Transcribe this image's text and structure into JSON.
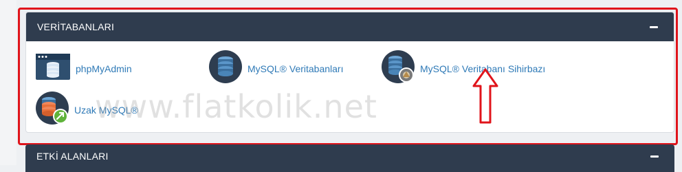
{
  "databases_panel": {
    "title": "VERİTABANLARI",
    "items": [
      {
        "label": "phpMyAdmin",
        "icon": "phpmyadmin-icon"
      },
      {
        "label": "MySQL® Veritabanları",
        "icon": "mysql-database-icon"
      },
      {
        "label": "MySQL® Veritabanı Sihirbazı",
        "icon": "mysql-database-wizard-icon"
      },
      {
        "label": "Uzak MySQL®",
        "icon": "remote-mysql-icon"
      }
    ]
  },
  "domains_panel": {
    "title": "ETKİ ALANLARI"
  },
  "watermark": "www.flatkolik.net",
  "colors": {
    "header_bg": "#2f3c4e",
    "link": "#2f7ab7",
    "highlight": "#e0141b",
    "db_blue": "#3b6f9e",
    "remote_orange": "#e8703a",
    "remote_green": "#5fb33a"
  }
}
